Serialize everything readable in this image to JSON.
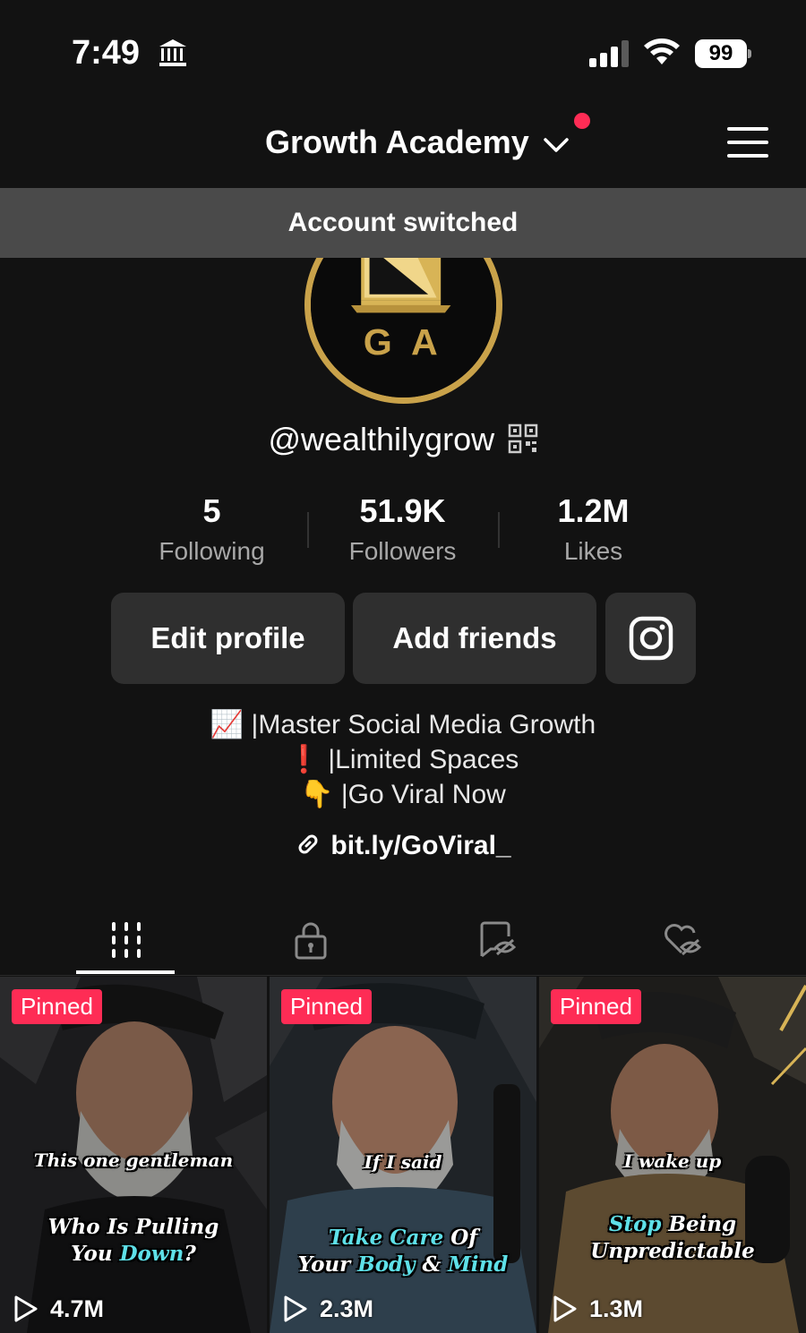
{
  "status_bar": {
    "time": "7:49",
    "battery": "99",
    "icons": [
      "bank-icon",
      "signal-icon",
      "wifi-icon",
      "battery-icon"
    ]
  },
  "header": {
    "account_name": "Growth Academy",
    "icons": [
      "chevron-down-icon",
      "notification-dot",
      "menu-icon"
    ],
    "accent": "#fe2c55"
  },
  "toast": {
    "message": "Account switched"
  },
  "profile": {
    "avatar_monogram": "G A",
    "handle": "@wealthilygrow",
    "stats": [
      {
        "value": "5",
        "label": "Following"
      },
      {
        "value": "51.9K",
        "label": "Followers"
      },
      {
        "value": "1.2M",
        "label": "Likes"
      }
    ],
    "buttons": {
      "edit": "Edit profile",
      "add": "Add friends",
      "instagram_icon": "instagram-icon"
    },
    "bio": [
      "📈 |Master Social Media Growth",
      "❗ |Limited Spaces",
      "👇 |Go Viral Now"
    ],
    "link": "bit.ly/GoViral_"
  },
  "tabs": [
    {
      "icon": "videos-grid-icon",
      "active": true
    },
    {
      "icon": "lock-icon",
      "active": false
    },
    {
      "icon": "reposts-hidden-icon",
      "active": false
    },
    {
      "icon": "liked-hidden-icon",
      "active": false
    }
  ],
  "videos": [
    {
      "badge": "Pinned",
      "caption_top": "This one gentleman",
      "caption_line1": "Who Is Pulling",
      "caption_line2_a": "You ",
      "caption_line2_hl": "Down",
      "caption_line2_b": "?",
      "views": "4.7M"
    },
    {
      "badge": "Pinned",
      "caption_top": "If I said",
      "caption_line1_hl": "Take Care",
      "caption_line1_b": " Of",
      "caption_line2_a": "Your ",
      "caption_line2_hl": "Body",
      "caption_line2_b": " & ",
      "caption_line2_hl2": "Mind",
      "views": "2.3M"
    },
    {
      "badge": "Pinned",
      "caption_top": "I wake up",
      "caption_line1_hl": "Stop",
      "caption_line1_b": " Being",
      "caption_line2": "Unpredictable",
      "views": "1.3M"
    }
  ]
}
